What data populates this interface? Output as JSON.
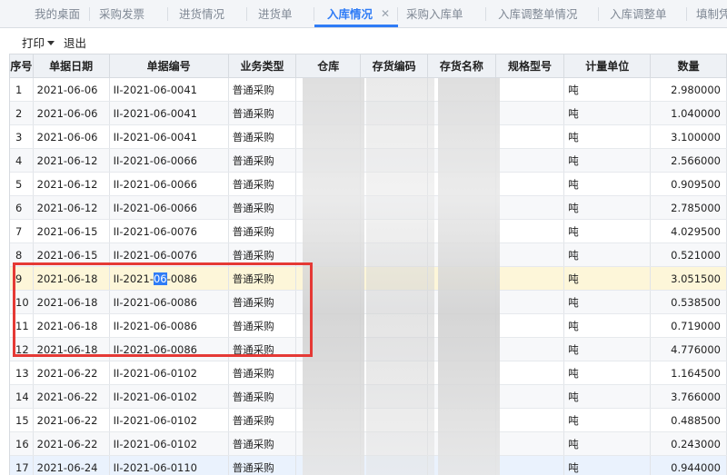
{
  "tabs": [
    {
      "label": "我的桌面"
    },
    {
      "label": "采购发票"
    },
    {
      "label": "进货情况"
    },
    {
      "label": "进货单"
    },
    {
      "label": "入库情况",
      "active": true
    },
    {
      "label": "采购入库单"
    },
    {
      "label": "入库调整单情况"
    },
    {
      "label": "入库调整单"
    },
    {
      "label": "填制凭"
    }
  ],
  "close_glyph": "✕",
  "toolbar": {
    "print_label": "打印",
    "exit_label": "退出"
  },
  "table": {
    "headers": [
      "序号",
      "单据日期",
      "单据编号",
      "业务类型",
      "仓库",
      "存货编码",
      "存货名称",
      "规格型号",
      "计量单位",
      "数量"
    ],
    "rows": [
      {
        "seq": "1",
        "date": "2021-06-06",
        "no": "II-2021-06-0041",
        "type": "普通采购",
        "unit": "吨",
        "qty": "2.980000"
      },
      {
        "seq": "2",
        "date": "2021-06-06",
        "no": "II-2021-06-0041",
        "type": "普通采购",
        "unit": "吨",
        "qty": "1.040000"
      },
      {
        "seq": "3",
        "date": "2021-06-06",
        "no": "II-2021-06-0041",
        "type": "普通采购",
        "unit": "吨",
        "qty": "3.100000"
      },
      {
        "seq": "4",
        "date": "2021-06-12",
        "no": "II-2021-06-0066",
        "type": "普通采购",
        "unit": "吨",
        "qty": "2.566000"
      },
      {
        "seq": "5",
        "date": "2021-06-12",
        "no": "II-2021-06-0066",
        "type": "普通采购",
        "unit": "吨",
        "qty": "0.909500"
      },
      {
        "seq": "6",
        "date": "2021-06-12",
        "no": "II-2021-06-0066",
        "type": "普通采购",
        "unit": "吨",
        "qty": "2.785000"
      },
      {
        "seq": "7",
        "date": "2021-06-15",
        "no": "II-2021-06-0076",
        "type": "普通采购",
        "unit": "吨",
        "qty": "4.029500"
      },
      {
        "seq": "8",
        "date": "2021-06-15",
        "no": "II-2021-06-0076",
        "type": "普通采购",
        "unit": "吨",
        "qty": "0.521000"
      },
      {
        "seq": "9",
        "date": "2021-06-18",
        "no_prefix": "II-2021-",
        "no_highlight": "06",
        "no_suffix": "-0086",
        "type": "普通采购",
        "unit": "吨",
        "qty": "3.051500"
      },
      {
        "seq": "10",
        "date": "2021-06-18",
        "no": "II-2021-06-0086",
        "type": "普通采购",
        "unit": "吨",
        "qty": "0.538500"
      },
      {
        "seq": "11",
        "date": "2021-06-18",
        "no": "II-2021-06-0086",
        "type": "普通采购",
        "unit": "吨",
        "qty": "0.719000"
      },
      {
        "seq": "12",
        "date": "2021-06-18",
        "no": "II-2021-06-0086",
        "type": "普通采购",
        "unit": "吨",
        "qty": "4.776000"
      },
      {
        "seq": "13",
        "date": "2021-06-22",
        "no": "II-2021-06-0102",
        "type": "普通采购",
        "unit": "吨",
        "qty": "1.164500"
      },
      {
        "seq": "14",
        "date": "2021-06-22",
        "no": "II-2021-06-0102",
        "type": "普通采购",
        "unit": "吨",
        "qty": "3.766000"
      },
      {
        "seq": "15",
        "date": "2021-06-22",
        "no": "II-2021-06-0102",
        "type": "普通采购",
        "unit": "吨",
        "qty": "0.488500"
      },
      {
        "seq": "16",
        "date": "2021-06-22",
        "no": "II-2021-06-0102",
        "type": "普通采购",
        "unit": "吨",
        "qty": "0.243000"
      },
      {
        "seq": "17",
        "date": "2021-06-24",
        "no": "II-2021-06-0110",
        "type": "普通采购",
        "unit": "吨",
        "qty": "0.944000"
      }
    ]
  },
  "colors": {
    "accent": "#2f7cf6",
    "annotation": "#e53935",
    "selected_row": "#fdf6d9"
  }
}
